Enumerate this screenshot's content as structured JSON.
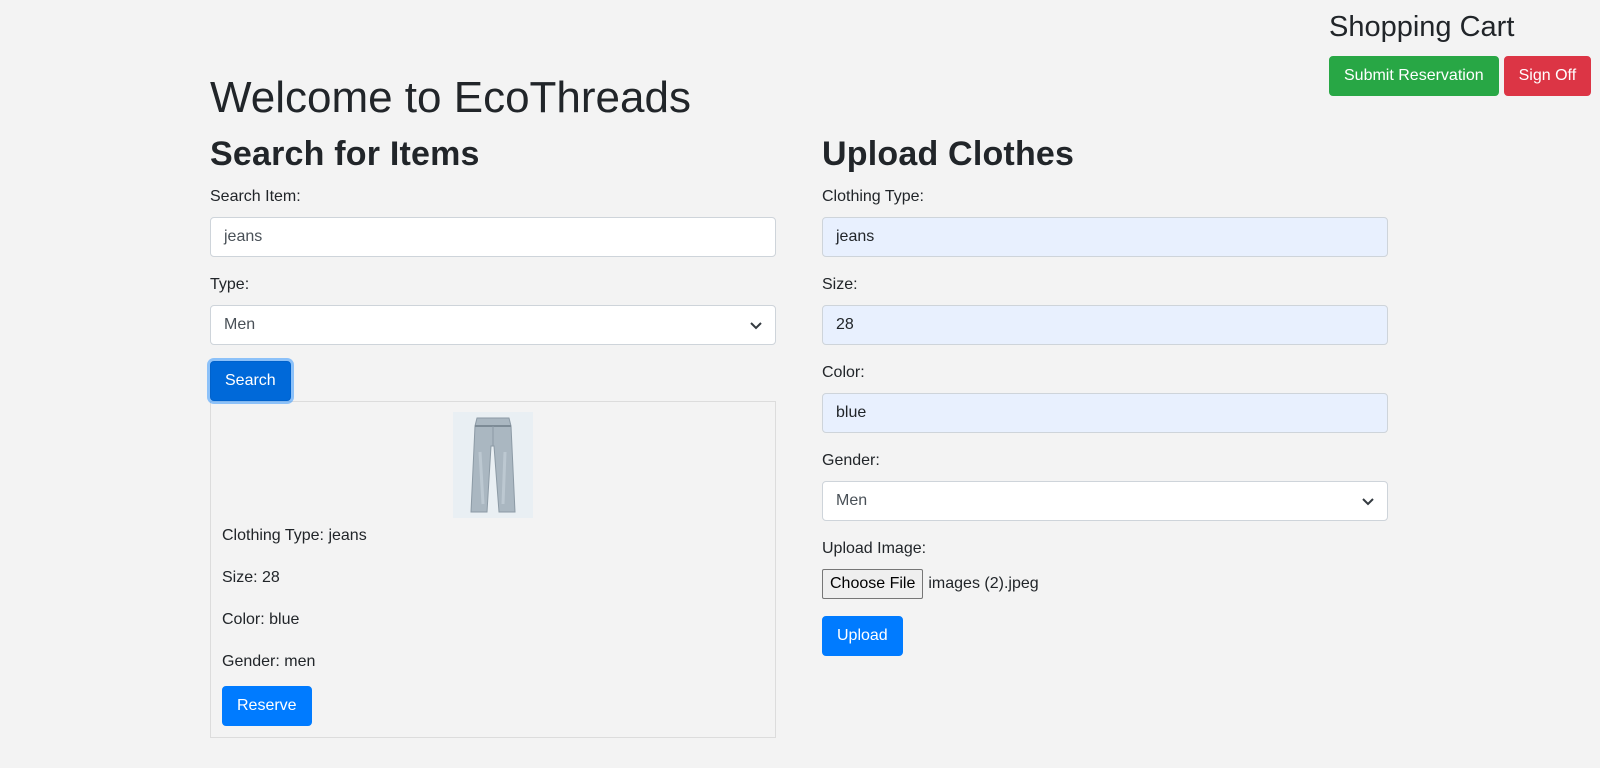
{
  "cart": {
    "title": "Shopping Cart",
    "submit_label": "Submit Reservation",
    "signoff_label": "Sign Off"
  },
  "page": {
    "title": "Welcome to EcoThreads"
  },
  "search": {
    "title": "Search for Items",
    "item_label": "Search Item:",
    "item_value": "jeans",
    "type_label": "Type:",
    "type_value": "Men",
    "button_label": "Search"
  },
  "result": {
    "image_icon": "jeans-image",
    "clothing_type": "Clothing Type: jeans",
    "size": "Size: 28",
    "color": "Color: blue",
    "gender": "Gender: men",
    "reserve_label": "Reserve"
  },
  "upload": {
    "title": "Upload Clothes",
    "type_label": "Clothing Type:",
    "type_value": "jeans",
    "size_label": "Size:",
    "size_value": "28",
    "color_label": "Color:",
    "color_value": "blue",
    "gender_label": "Gender:",
    "gender_value": "Men",
    "image_label": "Upload Image:",
    "choose_file_label": "Choose File",
    "file_name": "images (2).jpeg",
    "button_label": "Upload"
  },
  "colors": {
    "success": "#28a745",
    "danger": "#dc3545",
    "primary": "#007bff",
    "background": "#f3f3f3",
    "autofill": "#e8f0fe"
  }
}
